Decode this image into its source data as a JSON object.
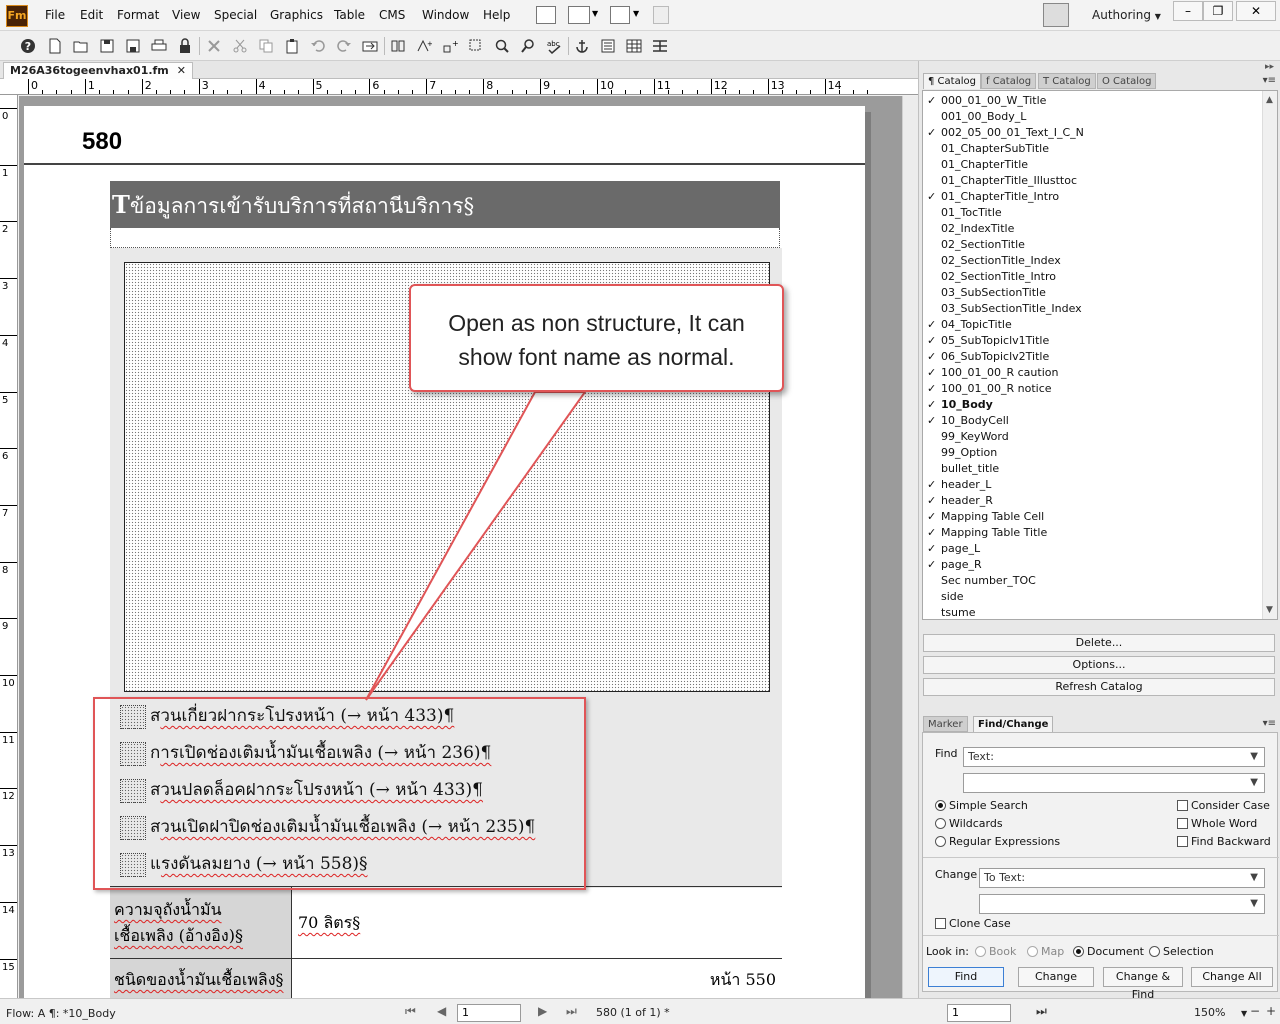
{
  "app": {
    "icon_text": "Fm",
    "menus": [
      "File",
      "Edit",
      "Format",
      "View",
      "Special",
      "Graphics",
      "Table",
      "CMS",
      "Window",
      "Help"
    ],
    "workspace": "Authoring",
    "window_buttons": [
      "–",
      "❐",
      "✕"
    ]
  },
  "document": {
    "tab_name": "M26A36togeenvhax01.fm",
    "ruler_h_labels": [
      "0",
      "1",
      "2",
      "3",
      "4",
      "5",
      "6",
      "7",
      "8",
      "9",
      "10",
      "11",
      "12",
      "13",
      "14"
    ],
    "ruler_v_labels": [
      "0",
      "1",
      "2",
      "3",
      "4",
      "5",
      "6",
      "7",
      "8",
      "9",
      "10",
      "11",
      "12",
      "13",
      "14",
      "15"
    ],
    "page_number": "580",
    "title_cap": "T",
    "title_text": "ข้อมูลการเข้ารับบริการที่สถานีบริการ§",
    "bullets": [
      {
        "lead": "ส",
        "text": "วนเกี่ยวฝากระโปรงหน้า (→ หน้า 433)¶"
      },
      {
        "lead": "ก",
        "text": "ารเปิดช่องเติมน้ำมันเชื้อเพลิง (→ หน้า 236)¶"
      },
      {
        "lead": "ส",
        "text": "วนปลดล็อคฝากระโปรงหน้า (→ หน้า 433)¶"
      },
      {
        "lead": "ส",
        "text": "วนเปิดฝาปิดช่องเติมน้ำมันเชื้อเพลิง (→ หน้า 235)¶"
      },
      {
        "lead": "แ",
        "text": "รงดันลมยาง (→ หน้า 558)§"
      }
    ],
    "table_rows": [
      {
        "label_line1": "ความจุถังน้ำมัน",
        "label_line2": "เชื้อเพลิง (อ้างอิง)§",
        "value": "70 ลิตร§"
      },
      {
        "label_line1": "ชนิดของน้ำมันเชื้อเพลิง§",
        "label_line2": "",
        "value": "หน้า 550"
      }
    ],
    "callout_line1": "Open as non structure, It can",
    "callout_line2": "show font name as normal."
  },
  "status": {
    "flow": "Flow: A  ¶: *10_Body",
    "page_input": "1",
    "pages": "580 (1 of 1) *",
    "right_input": "1",
    "zoom": "150%"
  },
  "catalog": {
    "tabs": [
      "¶ Catalog",
      "f Catalog",
      "T Catalog",
      "O Catalog"
    ],
    "items": [
      {
        "name": "000_01_00_W_Title",
        "check": "✓"
      },
      {
        "name": "001_00_Body_L",
        "check": ""
      },
      {
        "name": "002_05_00_01_Text_I_C_N",
        "check": "✓"
      },
      {
        "name": "01_ChapterSubTitle",
        "check": ""
      },
      {
        "name": "01_ChapterTitle",
        "check": ""
      },
      {
        "name": "01_ChapterTitle_Illusttoc",
        "check": ""
      },
      {
        "name": "01_ChapterTitle_Intro",
        "check": "✓"
      },
      {
        "name": "01_TocTitle",
        "check": ""
      },
      {
        "name": "02_IndexTitle",
        "check": ""
      },
      {
        "name": "02_SectionTitle",
        "check": ""
      },
      {
        "name": "02_SectionTitle_Index",
        "check": ""
      },
      {
        "name": "02_SectionTitle_Intro",
        "check": ""
      },
      {
        "name": "03_SubSectionTitle",
        "check": ""
      },
      {
        "name": "03_SubSectionTitle_Index",
        "check": ""
      },
      {
        "name": "04_TopicTitle",
        "check": "✓"
      },
      {
        "name": "05_SubTopiclv1Title",
        "check": "✓"
      },
      {
        "name": "06_SubTopiclv2Title",
        "check": "✓"
      },
      {
        "name": "100_01_00_R caution",
        "check": "✓"
      },
      {
        "name": "100_01_00_R notice",
        "check": "✓"
      },
      {
        "name": "10_Body",
        "check": "✓",
        "bold": true
      },
      {
        "name": "10_BodyCell",
        "check": "✓"
      },
      {
        "name": "99_KeyWord",
        "check": ""
      },
      {
        "name": "99_Option",
        "check": ""
      },
      {
        "name": "bullet_title",
        "check": ""
      },
      {
        "name": "header_L",
        "check": "✓"
      },
      {
        "name": "header_R",
        "check": "✓"
      },
      {
        "name": "Mapping Table Cell",
        "check": "✓"
      },
      {
        "name": "Mapping Table Title",
        "check": "✓"
      },
      {
        "name": "page_L",
        "check": "✓"
      },
      {
        "name": "page_R",
        "check": "✓"
      },
      {
        "name": "Sec number_TOC",
        "check": ""
      },
      {
        "name": "side",
        "check": ""
      },
      {
        "name": "tsume",
        "check": ""
      }
    ],
    "delete_btn": "Delete...",
    "options_btn": "Options...",
    "refresh_btn": "Refresh Catalog"
  },
  "find": {
    "tabs": [
      "Marker",
      "Find/Change"
    ],
    "find_label": "Find",
    "find_type": "Text:",
    "find_value": "",
    "opt_simple": "Simple Search",
    "opt_wildcards": "Wildcards",
    "opt_regex": "Regular Expressions",
    "opt_case": "Consider Case",
    "opt_whole": "Whole Word",
    "opt_backward": "Find Backward",
    "change_label": "Change",
    "change_type": "To Text:",
    "change_value": "",
    "clone_case": "Clone Case",
    "look_in": "Look in:",
    "scope_book": "Book",
    "scope_map": "Map",
    "scope_document": "Document",
    "scope_selection": "Selection",
    "btn_find": "Find",
    "btn_change": "Change",
    "btn_change_find": "Change & Find",
    "btn_change_all": "Change All"
  }
}
